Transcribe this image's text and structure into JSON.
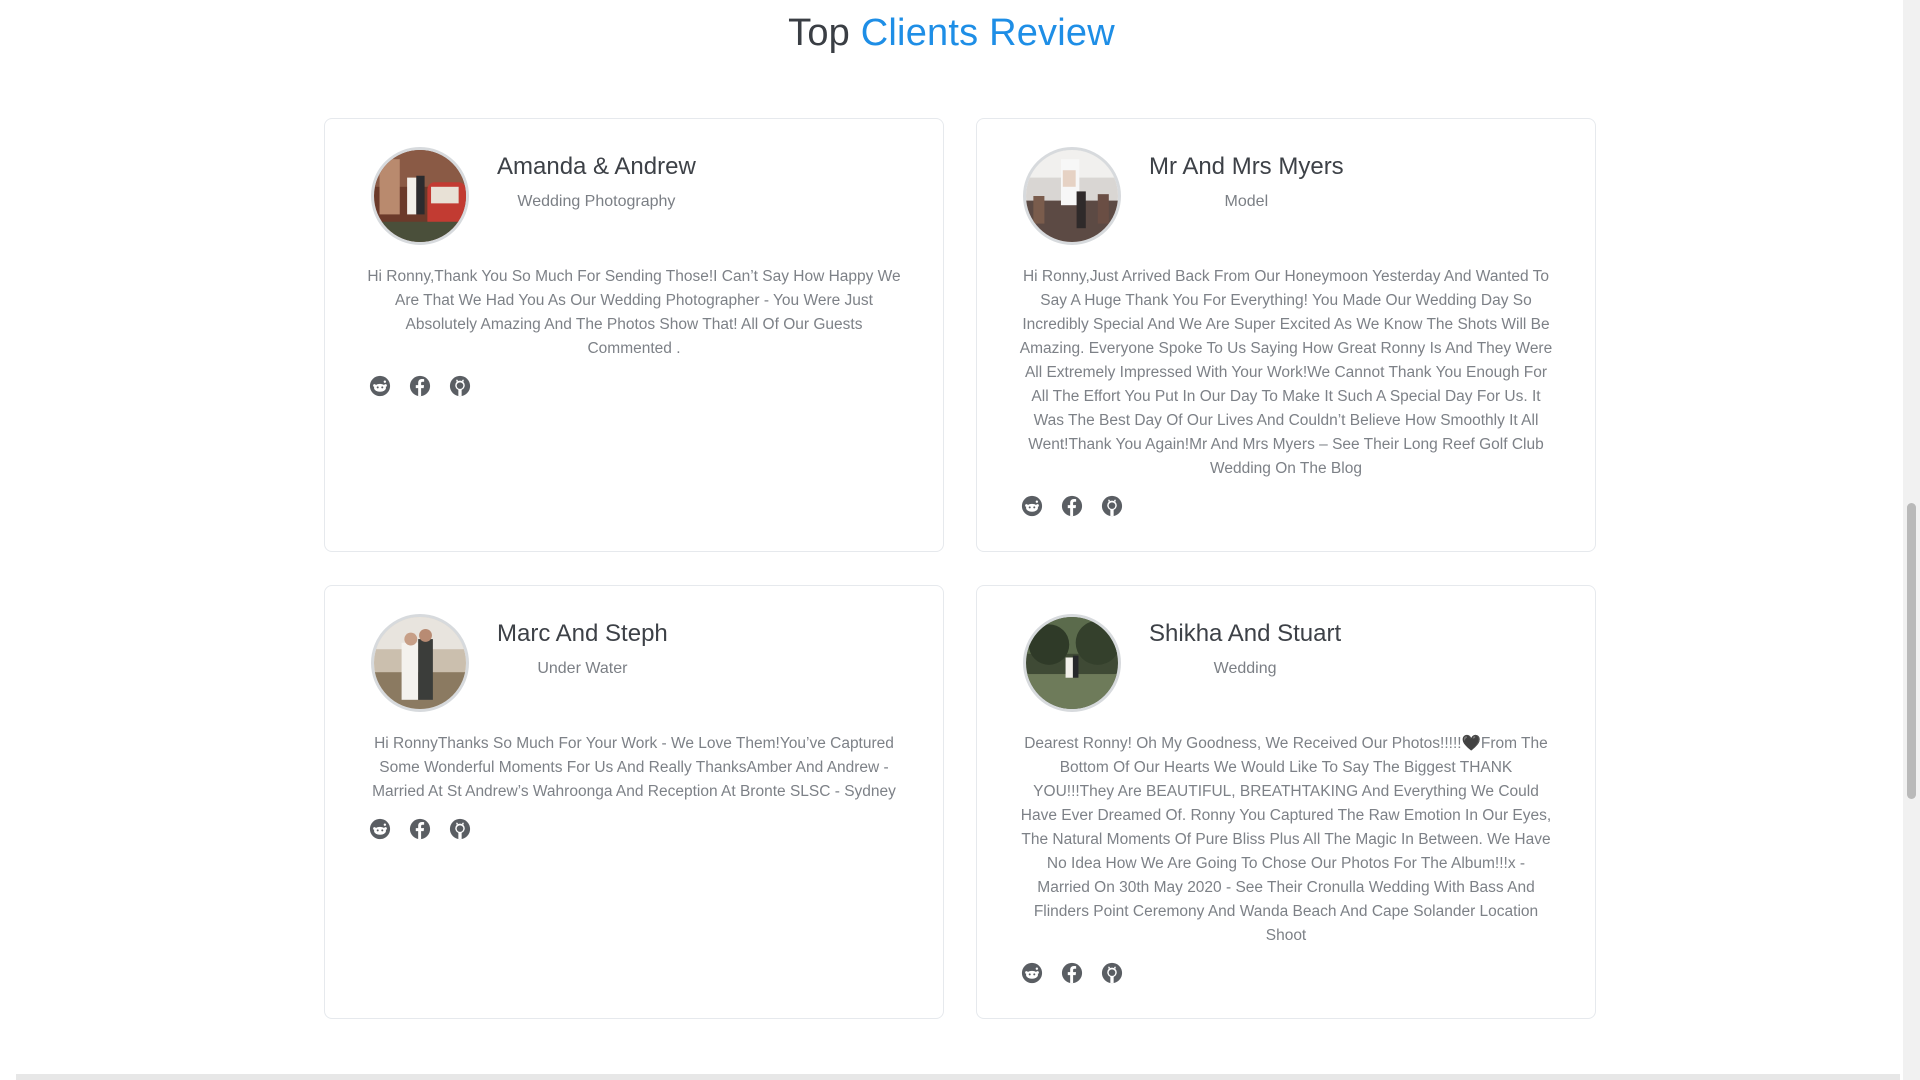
{
  "section": {
    "title_prefix": "Top",
    "title_accent": "Clients Review"
  },
  "colors": {
    "accent": "#1e8ee6",
    "heading": "#3a3e44",
    "body_text": "#7d8187",
    "icon": "#5a5e63"
  },
  "reviews": [
    {
      "name": "Amanda & Andrew",
      "role": "Wedding Photography",
      "text": "Hi Ronny,Thank You So Much For Sending Those!I Can’t Say How Happy We Are That We Had You As Our Wedding Photographer - You Were Just Absolutely Amazing And The Photos Show That! All Of Our Guests Commented .",
      "socials": [
        "reddit-icon",
        "facebook-icon",
        "github-icon"
      ]
    },
    {
      "name": "Mr And Mrs Myers",
      "role": "Model",
      "text": "Hi Ronny,Just Arrived Back From Our Honeymoon Yesterday And Wanted To Say A Huge Thank You For Everything! You Made Our Wedding Day So Incredibly Special And We Are Super Excited As We Know The Shots Will Be Amazing. Everyone Spoke To Us Saying How Great Ronny Is And They Were All Extremely Impressed With Your Work!We Cannot Thank You Enough For All The Effort You Put In Our Day To Make It Such A Special Day For Us. It Was The Best Day Of Our Lives And Couldn’t Believe How Smoothly It All Went!Thank You Again!Mr And Mrs Myers – See Their Long Reef Golf Club Wedding On The Blog",
      "socials": [
        "reddit-icon",
        "facebook-icon",
        "github-icon"
      ]
    },
    {
      "name": "Marc And Steph",
      "role": "Under Water",
      "text": "Hi RonnyThanks So Much For Your Work - We Love Them!You’ve Captured Some Wonderful Moments For Us And Really ThanksAmber And Andrew - Married At St Andrew’s Wahroonga And Reception At Bronte SLSC - Sydney",
      "socials": [
        "reddit-icon",
        "facebook-icon",
        "github-icon"
      ]
    },
    {
      "name": "Shikha And Stuart",
      "role": "Wedding",
      "text": "Dearest Ronny! Oh My Goodness, We Received Our Photos!!!!!🖤From The Bottom Of Our Hearts We Would Like To Say The Biggest THANK YOU!!!They Are BEAUTIFUL, BREATHTAKING And Everything We Could Have Ever Dreamed Of. Ronny You Captured The Raw Emotion In Our Eyes, The Natural Moments Of Pure Bliss Plus All The Magic In Between. We Have No Idea How We Are Going To Chose Our Photos For The Album!!!x - Married On 30th May 2020 - See Their Cronulla Wedding With Bass And Flinders Point Ceremony And Wanda Beach And Cape Solander Location Shoot",
      "socials": [
        "reddit-icon",
        "facebook-icon",
        "github-icon"
      ]
    }
  ]
}
